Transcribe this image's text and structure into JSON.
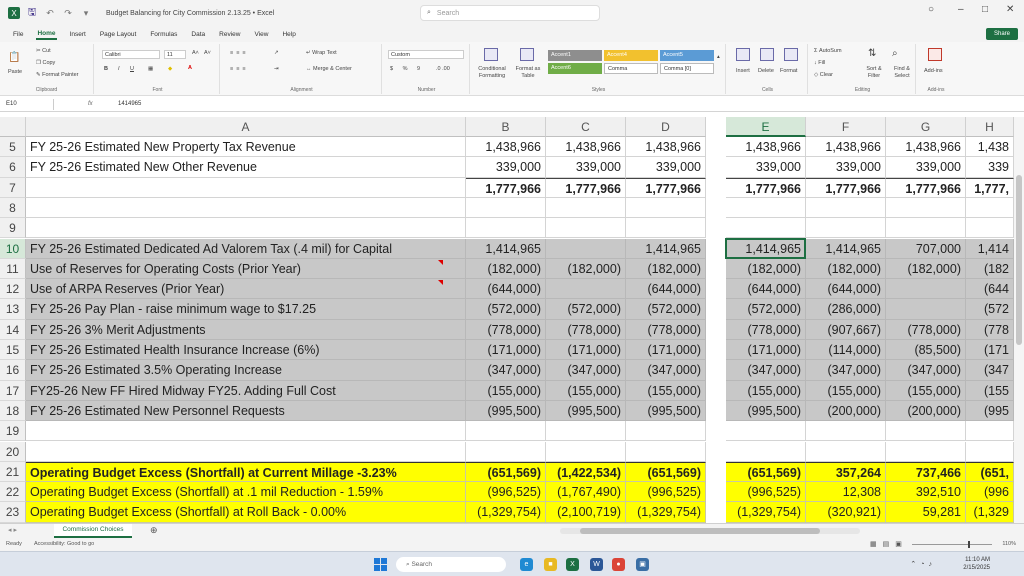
{
  "titlebar": {
    "title": "Budget Balancing for City Commission 2.13.25 • Excel",
    "search_placeholder": "Search"
  },
  "menu": {
    "tabs": [
      "File",
      "Home",
      "Insert",
      "Page Layout",
      "Formulas",
      "Data",
      "Review",
      "View",
      "Help"
    ],
    "share_label": "Share"
  },
  "ribbon": {
    "clipboard": {
      "paste": "Paste",
      "cut": "Cut",
      "copy": "Copy",
      "format_painter": "Format Painter",
      "label": "Clipboard"
    },
    "font": {
      "name": "Calibri",
      "size": "11",
      "label": "Font"
    },
    "alignment": {
      "wrap": "Wrap Text",
      "merge": "Merge & Center",
      "label": "Alignment"
    },
    "number": {
      "format": "Custom",
      "label": "Number"
    },
    "styles": {
      "conditional": "Conditional Formatting",
      "format_table": "Format as Table",
      "cells": [
        {
          "label": "Accent1",
          "color": "#8e8e8e"
        },
        {
          "label": "Accent4",
          "color": "#f2c12e"
        },
        {
          "label": "Accent5",
          "color": "#5b9bd5"
        },
        {
          "label": "Accent6",
          "color": "#70ad47"
        },
        {
          "label": "Comma",
          "color": "#ffffff"
        },
        {
          "label": "Comma [0]",
          "color": "#ffffff"
        }
      ],
      "label": "Styles"
    },
    "cells_group": {
      "insert": "Insert",
      "delete": "Delete",
      "format": "Format",
      "label": "Cells"
    },
    "editing": {
      "autosum": "AutoSum",
      "fill": "Fill",
      "clear": "Clear",
      "sort": "Sort & Filter",
      "find": "Find & Select",
      "label": "Editing"
    },
    "addins": {
      "label": "Add-ins",
      "group": "Add-ins"
    }
  },
  "formula_bar": {
    "name_box": "E10",
    "fx": "fx",
    "value": "1414965"
  },
  "columns": [
    "A",
    "B",
    "C",
    "D",
    "E",
    "F",
    "G",
    "H"
  ],
  "selected_column": "E",
  "rows": [
    {
      "n": "5",
      "label": "FY 25-26 Estimated New Property Tax Revenue",
      "style": "normal",
      "values": [
        "1,438,966",
        "1,438,966",
        "1,438,966",
        "1,438,966",
        "1,438,966",
        "1,438,966",
        "1,438"
      ]
    },
    {
      "n": "6",
      "label": "FY 25-26 Estimated New Other Revenue",
      "style": "normal",
      "values": [
        "339,000",
        "339,000",
        "339,000",
        "339,000",
        "339,000",
        "339,000",
        "339"
      ]
    },
    {
      "n": "7",
      "label": "",
      "style": "bold-topline",
      "values": [
        "1,777,966",
        "1,777,966",
        "1,777,966",
        "1,777,966",
        "1,777,966",
        "1,777,966",
        "1,777,"
      ]
    },
    {
      "n": "8",
      "label": "",
      "style": "normal",
      "values": [
        "",
        "",
        "",
        "",
        "",
        "",
        ""
      ]
    },
    {
      "n": "9",
      "label": "",
      "style": "normal",
      "values": [
        "",
        "",
        "",
        "",
        "",
        "",
        ""
      ]
    },
    {
      "n": "10",
      "label": "FY 25-26 Estimated Dedicated Ad Valorem Tax (.4 mil) for Capital",
      "style": "gray",
      "values": [
        "1,414,965",
        "",
        "1,414,965",
        "1,414,965",
        "1,414,965",
        "707,000",
        "1,414"
      ]
    },
    {
      "n": "11",
      "label": "Use of Reserves for Operating Costs (Prior Year)",
      "style": "gray",
      "values": [
        "(182,000)",
        "(182,000)",
        "(182,000)",
        "(182,000)",
        "(182,000)",
        "(182,000)",
        "(182"
      ]
    },
    {
      "n": "12",
      "label": "Use of ARPA Reserves (Prior Year)",
      "style": "gray",
      "values": [
        "(644,000)",
        "",
        "(644,000)",
        "(644,000)",
        "(644,000)",
        "",
        "(644"
      ]
    },
    {
      "n": "13",
      "label": "FY 25-26 Pay Plan - raise minimum wage to $17.25",
      "style": "gray",
      "values": [
        "(572,000)",
        "(572,000)",
        "(572,000)",
        "(572,000)",
        "(286,000)",
        "",
        "(572"
      ]
    },
    {
      "n": "14",
      "label": "FY 25-26 3% Merit Adjustments",
      "style": "gray",
      "values": [
        "(778,000)",
        "(778,000)",
        "(778,000)",
        "(778,000)",
        "(907,667)",
        "(778,000)",
        "(778"
      ]
    },
    {
      "n": "15",
      "label": "FY 25-26 Estimated Health Insurance Increase (6%)",
      "style": "gray",
      "values": [
        "(171,000)",
        "(171,000)",
        "(171,000)",
        "(171,000)",
        "(114,000)",
        "(85,500)",
        "(171"
      ]
    },
    {
      "n": "16",
      "label": "FY 25-26 Estimated 3.5% Operating Increase",
      "style": "gray",
      "values": [
        "(347,000)",
        "(347,000)",
        "(347,000)",
        "(347,000)",
        "(347,000)",
        "(347,000)",
        "(347"
      ]
    },
    {
      "n": "17",
      "label": "FY25-26 New FF Hired Midway FY25. Adding Full Cost",
      "style": "gray",
      "values": [
        "(155,000)",
        "(155,000)",
        "(155,000)",
        "(155,000)",
        "(155,000)",
        "(155,000)",
        "(155"
      ]
    },
    {
      "n": "18",
      "label": "FY 25-26 Estimated New Personnel Requests",
      "style": "gray",
      "values": [
        "(995,500)",
        "(995,500)",
        "(995,500)",
        "(995,500)",
        "(200,000)",
        "(200,000)",
        "(995"
      ]
    },
    {
      "n": "19",
      "label": "",
      "style": "normal",
      "values": [
        "",
        "",
        "",
        "",
        "",
        "",
        ""
      ]
    },
    {
      "n": "20",
      "label": "",
      "style": "normal",
      "values": [
        "",
        "",
        "",
        "",
        "",
        "",
        ""
      ]
    },
    {
      "n": "21",
      "label": "Operating Budget Excess (Shortfall) at Current Millage -3.23%",
      "style": "yellow-bold",
      "values": [
        "(651,569)",
        "(1,422,534)",
        "(651,569)",
        "(651,569)",
        "357,264",
        "737,466",
        "(651,"
      ]
    },
    {
      "n": "22",
      "label": "Operating Budget Excess (Shortfall) at .1 mil Reduction - 1.59%",
      "style": "yellow",
      "values": [
        "(996,525)",
        "(1,767,490)",
        "(996,525)",
        "(996,525)",
        "12,308",
        "392,510",
        "(996"
      ]
    },
    {
      "n": "23",
      "label": "Operating Budget Excess (Shortfall) at Roll Back - 0.00%",
      "style": "yellow",
      "values": [
        "(1,329,754)",
        "(2,100,719)",
        "(1,329,754)",
        "(1,329,754)",
        "(320,921)",
        "59,281",
        "(1,329"
      ]
    }
  ],
  "sheet_tabs": [
    "Commission Choices"
  ],
  "status": {
    "ready": "Ready",
    "accessibility": "Accessibility: Good to go",
    "zoom": "110%"
  },
  "taskbar": {
    "search": "Search",
    "time": "11:10 AM",
    "date": "2/15/2025"
  }
}
